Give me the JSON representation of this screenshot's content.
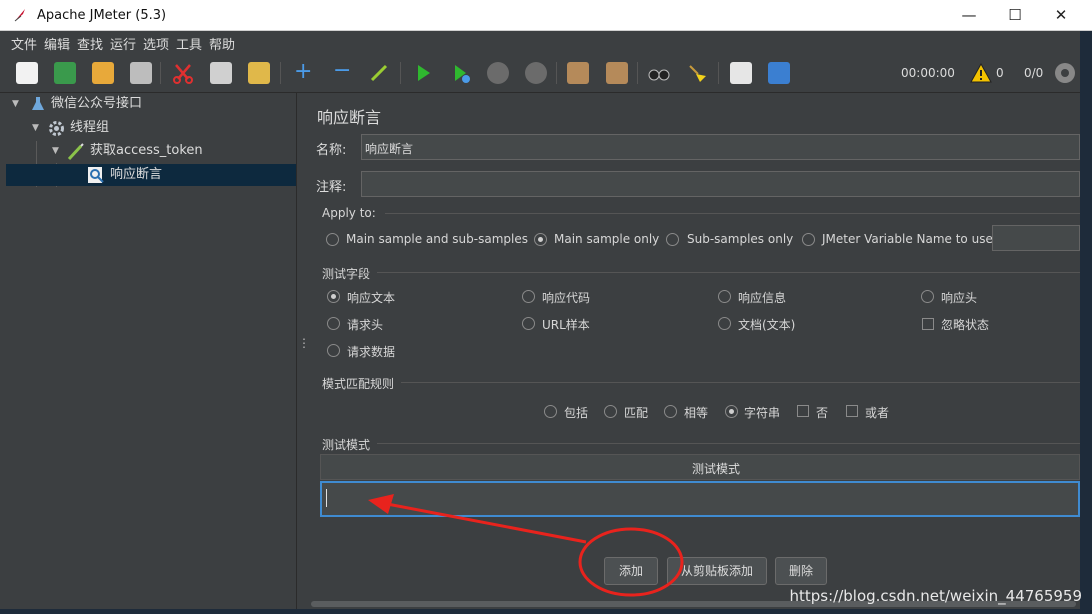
{
  "window": {
    "title": "Apache JMeter (5.3)"
  },
  "menu": [
    "文件",
    "编辑",
    "查找",
    "运行",
    "选项",
    "工具",
    "帮助"
  ],
  "toolbar": {
    "timer": "00:00:00",
    "warnings": "0",
    "threads": "0/0"
  },
  "tree": {
    "items": [
      {
        "label": "微信公众号接口",
        "icon": "test-plan-flask-icon"
      },
      {
        "label": "线程组",
        "icon": "thread-group-gear-icon"
      },
      {
        "label": "获取access_token",
        "icon": "http-sampler-pen-icon"
      },
      {
        "label": "响应断言",
        "icon": "response-assertion-magnifier-icon"
      }
    ]
  },
  "panel": {
    "title": "响应断言",
    "name_label": "名称:",
    "name_value": "响应断言",
    "comment_label": "注释:",
    "comment_value": "",
    "apply_to": {
      "label": "Apply to:",
      "options": [
        "Main sample and sub-samples",
        "Main sample only",
        "Sub-samples only",
        "JMeter Variable Name to use"
      ],
      "selected": "Main sample only",
      "variable_value": ""
    },
    "test_field": {
      "label": "测试字段",
      "options": [
        "响应文本",
        "响应代码",
        "响应信息",
        "响应头",
        "请求头",
        "URL样本",
        "文档(文本)",
        "忽略状态",
        "请求数据"
      ],
      "selected": "响应文本"
    },
    "pattern_rules": {
      "label": "模式匹配规则",
      "options": [
        "包括",
        "匹配",
        "相等",
        "字符串",
        "否",
        "或者"
      ],
      "selected": "字符串"
    },
    "patterns": {
      "label": "测试模式",
      "column_header": "测试模式",
      "rows": [
        ""
      ]
    },
    "buttons": {
      "add": "添加",
      "add_clipboard": "从剪贴板添加",
      "delete": "删除"
    }
  },
  "watermark": "https://blog.csdn.net/weixin_44765959",
  "colors": {
    "accent_red": "#e8231d",
    "selection": "#0d293e",
    "panel_bg": "#3c3f41"
  }
}
